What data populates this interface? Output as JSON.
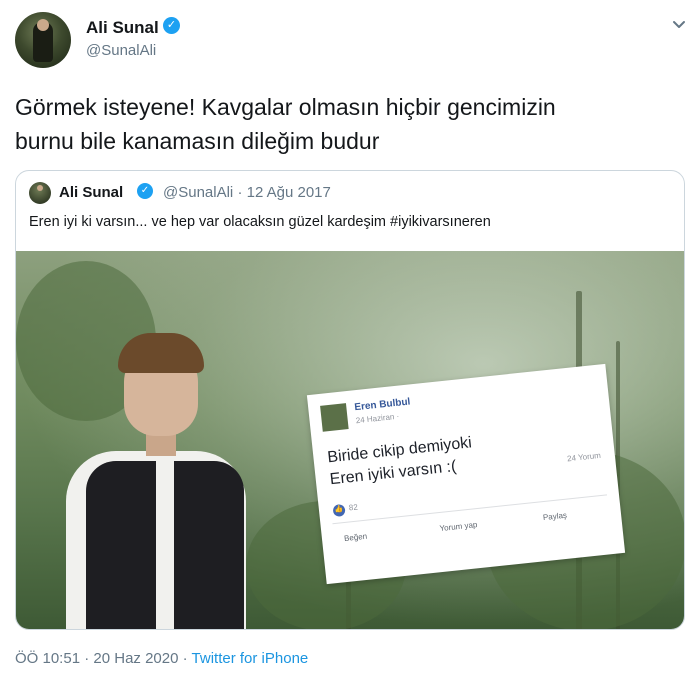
{
  "author": {
    "name": "Ali Sunal",
    "handle": "@SunalAli",
    "verified_icon": "verified-badge-icon"
  },
  "tweet": {
    "text_line1": "Görmek isteyene! Kavgalar olmasın hiçbir gencimizin",
    "text_line2": "burnu bile kanamasın dileğim budur"
  },
  "quoted": {
    "name": "Ali Sunal",
    "handle": "@SunalAli",
    "separator": "·",
    "date": "12 Ağu 2017",
    "text": "Eren iyi ki varsın... ve hep var olacaksın güzel kardeşim #iyikivarsıneren",
    "photo_card": {
      "name": "Eren Bulbul",
      "date": "24 Haziran ·",
      "line1": "Biride cikip demiyoki",
      "line2": "Eren iyiki varsın :(",
      "comments": "24 Yorum",
      "likes": "82",
      "actions": [
        "Beğen",
        "Yorum yap",
        "Paylaş"
      ]
    }
  },
  "footer": {
    "time": "ÖÖ 10:51",
    "sep1": "·",
    "date": "20 Haz 2020",
    "sep2": "·",
    "client": "Twitter for iPhone"
  },
  "colors": {
    "accent": "#1da1f2",
    "muted": "#657786",
    "link": "#1b95e0"
  }
}
